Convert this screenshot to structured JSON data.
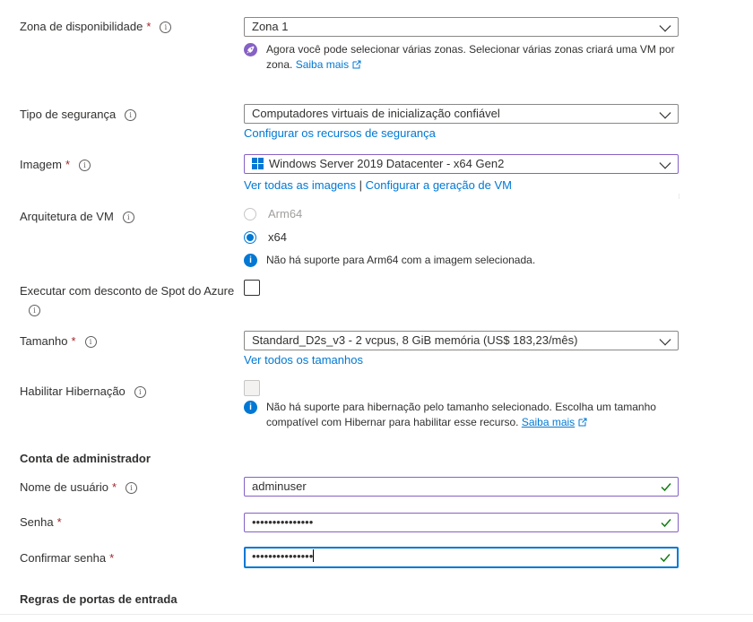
{
  "zona": {
    "label": "Zona de disponibilidade",
    "required": "*",
    "value": "Zona 1",
    "notice_text": "Agora você pode selecionar várias zonas. Selecionar várias zonas criará uma VM por zona.",
    "notice_link": "Saiba mais"
  },
  "seguranca": {
    "label": "Tipo de segurança",
    "value": "Computadores virtuais de inicialização confiável",
    "link": "Configurar os recursos de segurança"
  },
  "imagem": {
    "label": "Imagem",
    "required": "*",
    "value": "Windows Server 2019 Datacenter - x64 Gen2",
    "link_all": "Ver todas as imagens",
    "separator": "|",
    "link_config": "Configurar a geração de VM"
  },
  "arquitetura": {
    "label": "Arquitetura de VM",
    "options": [
      {
        "label": "Arm64",
        "state": "disabled"
      },
      {
        "label": "x64",
        "state": "checked"
      }
    ],
    "notice": "Não há suporte para Arm64 com a imagem selecionada."
  },
  "spot": {
    "label": "Executar com desconto de Spot do Azure"
  },
  "tamanho": {
    "label": "Tamanho",
    "required": "*",
    "value": "Standard_D2s_v3 - 2 vcpus, 8 GiB memória (US$ 183,23/mês)",
    "link": "Ver todos os tamanhos"
  },
  "hibernacao": {
    "label": "Habilitar Hibernação",
    "notice_text": "Não há suporte para hibernação pelo tamanho selecionado. Escolha um tamanho compatível com Hibernar para habilitar esse recurso.",
    "notice_link": "Saiba mais"
  },
  "admin": {
    "section_title": "Conta de administrador",
    "username_label": "Nome de usuário",
    "username_value": "adminuser",
    "password_label": "Senha",
    "password_value": "•••••••••••••••",
    "confirm_label": "Confirmar senha",
    "confirm_value": "•••••••••••••••",
    "required": "*"
  },
  "portas": {
    "section_title": "Regras de portas de entrada"
  },
  "icons": {
    "info": "i",
    "rocket": "rocket-icon",
    "info_filled": "i"
  },
  "colors": {
    "link": "#0078d4",
    "required": "#a4262c",
    "valid": "#107c10",
    "purple_border": "#8661c5",
    "rocket_badge": "#8661c5"
  }
}
